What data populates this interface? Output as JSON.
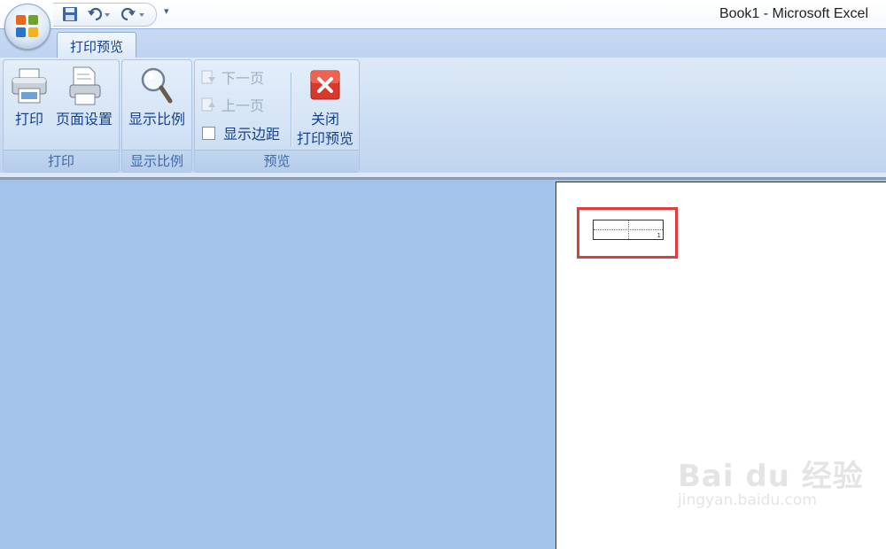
{
  "window": {
    "title": "Book1 - Microsoft Excel"
  },
  "quick_access": {
    "items": [
      {
        "icon": "save-icon"
      },
      {
        "icon": "undo-icon"
      },
      {
        "icon": "redo-icon"
      },
      {
        "icon": "customize-qat-icon",
        "glyph": "▾"
      }
    ]
  },
  "ribbon": {
    "active_tab": "打印预览",
    "groups": {
      "print": {
        "label": "打印",
        "buttons": {
          "print": "打印",
          "page_setup": "页面设置"
        }
      },
      "zoom": {
        "label": "显示比例",
        "buttons": {
          "zoom": "显示比例"
        }
      },
      "preview": {
        "label": "预览",
        "buttons": {
          "next_page": "下一页",
          "prev_page": "上一页",
          "show_margins": "显示边距",
          "close_line1": "关闭",
          "close_line2": "打印预览"
        },
        "show_margins_checked": false
      }
    }
  },
  "preview_page": {
    "page_number": "1"
  },
  "watermark": {
    "brand": "Bai du 经验",
    "sub": "jingyan.baidu.com"
  },
  "colors": {
    "accent": "#15428b",
    "highlight": "#e03c3c",
    "workspace": "#a3c3ea"
  }
}
